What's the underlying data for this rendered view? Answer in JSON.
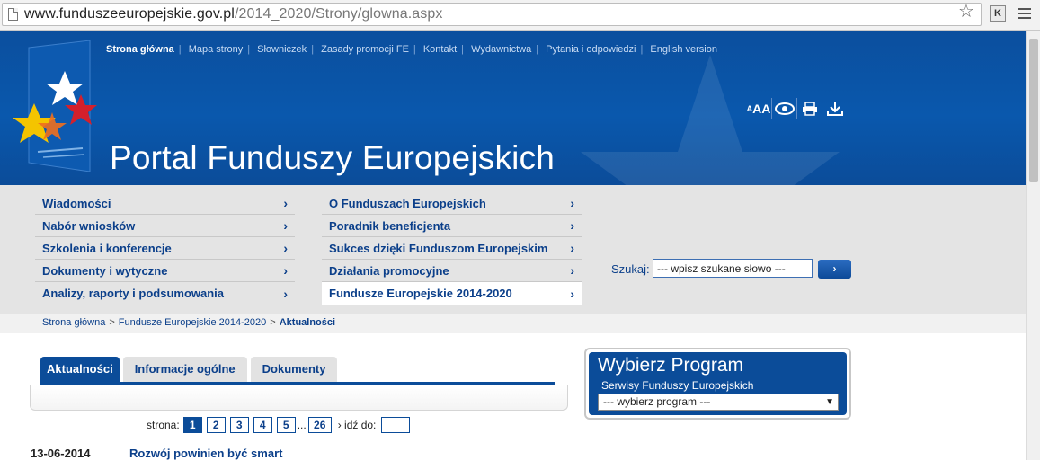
{
  "browser": {
    "url_host": "www.funduszeeuropejskie.gov.pl",
    "url_path": "/2014_2020/Strony/glowna.aspx",
    "extension_label": "K"
  },
  "header": {
    "top_nav": [
      {
        "label": "Strona główna",
        "active": true
      },
      {
        "label": "Mapa strony"
      },
      {
        "label": "Słowniczek"
      },
      {
        "label": "Zasady promocji FE"
      },
      {
        "label": "Kontakt"
      },
      {
        "label": "Wydawnictwa"
      },
      {
        "label": "Pytania i odpowiedzi"
      },
      {
        "label": "English version"
      }
    ],
    "tools": {
      "font_size_small": "A",
      "font_size_large": "AA"
    },
    "title": "Portal Funduszy Europejskich"
  },
  "nav": {
    "col1": [
      {
        "label": "Wiadomości"
      },
      {
        "label": "Nabór wniosków"
      },
      {
        "label": "Szkolenia i konferencje"
      },
      {
        "label": "Dokumenty i wytyczne"
      },
      {
        "label": "Analizy, raporty i podsumowania"
      }
    ],
    "col2": [
      {
        "label": "O Funduszach Europejskich"
      },
      {
        "label": "Poradnik beneficjenta"
      },
      {
        "label": "Sukces dzięki Funduszom Europejskim"
      },
      {
        "label": "Działania promocyjne"
      },
      {
        "label": "Fundusze Europejskie 2014-2020",
        "selected": true
      }
    ],
    "chevron": "›"
  },
  "search": {
    "label": "Szukaj:",
    "placeholder": "--- wpisz szukane słowo ---",
    "button": "›"
  },
  "breadcrumb": {
    "items": [
      "Strona główna",
      "Fundusze Europejskie 2014-2020"
    ],
    "current": "Aktualności",
    "separator": ">"
  },
  "tabs": [
    {
      "label": "Aktualności",
      "active": true
    },
    {
      "label": "Informacje ogólne"
    },
    {
      "label": "Dokumenty"
    }
  ],
  "pager": {
    "label": "strona:",
    "pages": [
      "1",
      "2",
      "3",
      "4",
      "5"
    ],
    "dots": "...",
    "last": "26",
    "goto_label": "› idź do:"
  },
  "news": [
    {
      "date": "13-06-2014",
      "title": "Rozwój powinien być smart"
    }
  ],
  "program": {
    "title": "Wybierz Program",
    "subtitle": "Serwisy Funduszy Europejskich",
    "select_value": "--- wybierz program ---"
  },
  "colors": {
    "brand_blue": "#0b4c99",
    "nav_band": "#e4e4e4"
  }
}
